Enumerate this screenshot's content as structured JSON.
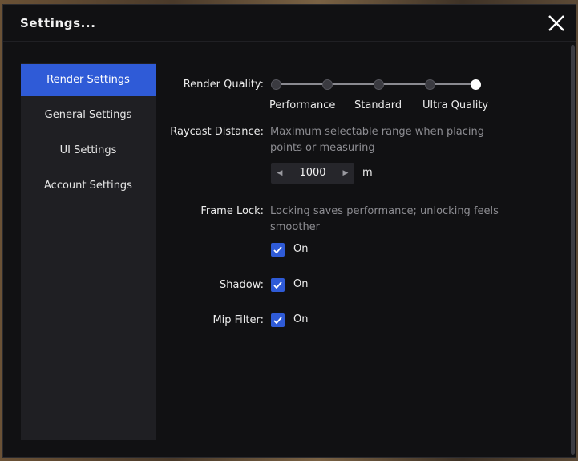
{
  "dialog": {
    "title": "Settings..."
  },
  "sidebar": {
    "items": [
      {
        "label": "Render Settings"
      },
      {
        "label": "General Settings"
      },
      {
        "label": "UI Settings"
      },
      {
        "label": "Account Settings"
      }
    ],
    "active": "Render Settings"
  },
  "render": {
    "quality": {
      "label": "Render Quality:",
      "ticks": [
        "Performance",
        "Standard",
        "Ultra Quality"
      ],
      "steps": 5,
      "selected_step": 5
    },
    "raycast": {
      "label": "Raycast Distance:",
      "description": "Maximum selectable range when placing points or measuring",
      "value": "1000",
      "unit": "m"
    },
    "frame_lock": {
      "label": "Frame Lock:",
      "description": "Locking saves performance; unlocking feels smoother",
      "checked": true,
      "check_label": "On"
    },
    "shadow": {
      "label": "Shadow:",
      "checked": true,
      "check_label": "On"
    },
    "mip_filter": {
      "label": "Mip Filter:",
      "checked": true,
      "check_label": "On"
    }
  },
  "colors": {
    "accent": "#2f5bd7",
    "background": "#111113",
    "sidebar": "#1f1f23"
  },
  "icons": {
    "close": "close-icon",
    "check": "checkmark-icon",
    "left": "caret-left-icon",
    "right": "caret-right-icon"
  }
}
